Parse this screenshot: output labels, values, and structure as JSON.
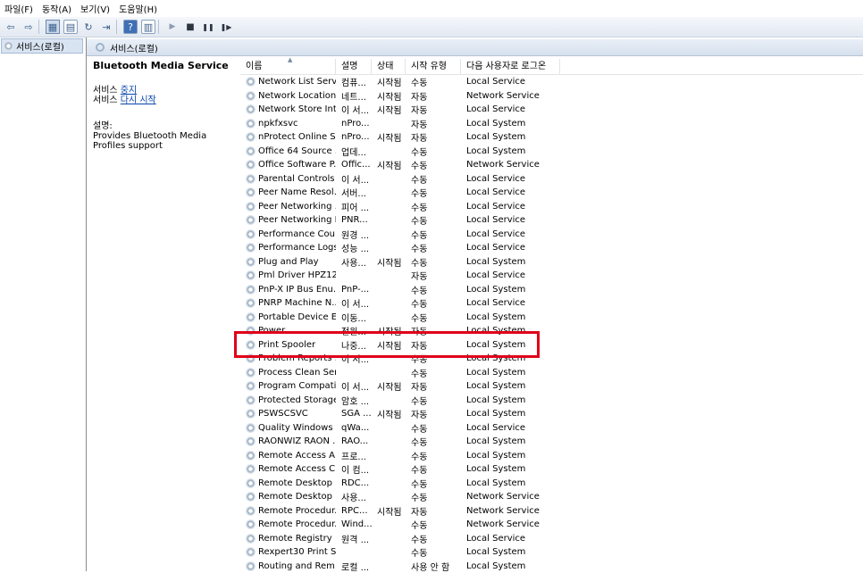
{
  "menu": [
    "파일(F)",
    "동작(A)",
    "보기(V)",
    "도움말(H)"
  ],
  "toolbar": {
    "back_icon": "back-arrow-icon",
    "forward_icon": "forward-arrow-icon",
    "play": "▶",
    "stop": "■",
    "pause": "❚❚",
    "resume": "❚▶"
  },
  "tree": {
    "item": "서비스(로컬)"
  },
  "main": {
    "title": "서비스(로컬)",
    "selected_service": "Bluetooth Media Service",
    "stop_prefix": "서비스 ",
    "stop_link": "중지",
    "restart_prefix": "서비스 ",
    "restart_link": "다시 시작",
    "desc_label": "설명:",
    "desc_text": "Provides Bluetooth Media Profiles support"
  },
  "columns": [
    "이름",
    "설명",
    "상태",
    "시작 유형",
    "다음 사용자로 로그온"
  ],
  "rows": [
    [
      "Network List Servi...",
      "컴퓨...",
      "시작됨",
      "수동",
      "Local Service"
    ],
    [
      "Network Location...",
      "네트...",
      "시작됨",
      "자동",
      "Network Service"
    ],
    [
      "Network Store Int...",
      "이 서...",
      "시작됨",
      "자동",
      "Local Service"
    ],
    [
      "npkfxsvc",
      "nPro...",
      "",
      "자동",
      "Local System"
    ],
    [
      "nProtect Online S...",
      "nPro...",
      "시작됨",
      "자동",
      "Local System"
    ],
    [
      "Office 64 Source ...",
      "업데...",
      "",
      "수동",
      "Local System"
    ],
    [
      "Office Software P...",
      "Offic...",
      "시작됨",
      "수동",
      "Network Service"
    ],
    [
      "Parental Controls",
      "이 서...",
      "",
      "수동",
      "Local Service"
    ],
    [
      "Peer Name Resol...",
      "서버...",
      "",
      "수동",
      "Local Service"
    ],
    [
      "Peer Networking ...",
      "피어 ...",
      "",
      "수동",
      "Local Service"
    ],
    [
      "Peer Networking I...",
      "PNR...",
      "",
      "수동",
      "Local Service"
    ],
    [
      "Performance Cou...",
      "원경 ...",
      "",
      "수동",
      "Local Service"
    ],
    [
      "Performance Logs...",
      "성능 ...",
      "",
      "수동",
      "Local Service"
    ],
    [
      "Plug and Play",
      "사용...",
      "시작됨",
      "수동",
      "Local System"
    ],
    [
      "Pml Driver HPZ12",
      "",
      "",
      "자동",
      "Local Service"
    ],
    [
      "PnP-X IP Bus Enu...",
      "PnP-...",
      "",
      "수동",
      "Local System"
    ],
    [
      "PNRP Machine N...",
      "이 서...",
      "",
      "수동",
      "Local Service"
    ],
    [
      "Portable Device E...",
      "이동...",
      "",
      "수동",
      "Local System"
    ],
    [
      "Power",
      "전원...",
      "시작됨",
      "자동",
      "Local System"
    ],
    [
      "Print Spooler",
      "나중...",
      "시작됨",
      "자동",
      "Local System"
    ],
    [
      "Problem Reports ...",
      "이 서...",
      "",
      "수동",
      "Local System"
    ],
    [
      "Process Clean Ser...",
      "",
      "",
      "수동",
      "Local System"
    ],
    [
      "Program Compati...",
      "이 서...",
      "시작됨",
      "자동",
      "Local System"
    ],
    [
      "Protected Storage",
      "암호 ...",
      "",
      "수동",
      "Local System"
    ],
    [
      "PSWSCSVC",
      "SGA ...",
      "시작됨",
      "자동",
      "Local System"
    ],
    [
      "Quality Windows ...",
      "qWa...",
      "",
      "수동",
      "Local Service"
    ],
    [
      "RAONWIZ RAON ...",
      "RAO...",
      "",
      "수동",
      "Local System"
    ],
    [
      "Remote Access A...",
      "프로...",
      "",
      "수동",
      "Local System"
    ],
    [
      "Remote Access C...",
      "이 컴...",
      "",
      "수동",
      "Local System"
    ],
    [
      "Remote Desktop ...",
      "RDC...",
      "",
      "수동",
      "Local System"
    ],
    [
      "Remote Desktop ...",
      "사용...",
      "",
      "수동",
      "Network Service"
    ],
    [
      "Remote Procedur...",
      "RPC...",
      "시작됨",
      "자동",
      "Network Service"
    ],
    [
      "Remote Procedur...",
      "Wind...",
      "",
      "수동",
      "Network Service"
    ],
    [
      "Remote Registry",
      "원격 ...",
      "",
      "수동",
      "Local Service"
    ],
    [
      "Rexpert30 Print S...",
      "",
      "",
      "수동",
      "Local System"
    ],
    [
      "Routing and Rem...",
      "로컬 ...",
      "",
      "사용 안 함",
      "Local System"
    ]
  ],
  "highlight_color": "#e0001a"
}
